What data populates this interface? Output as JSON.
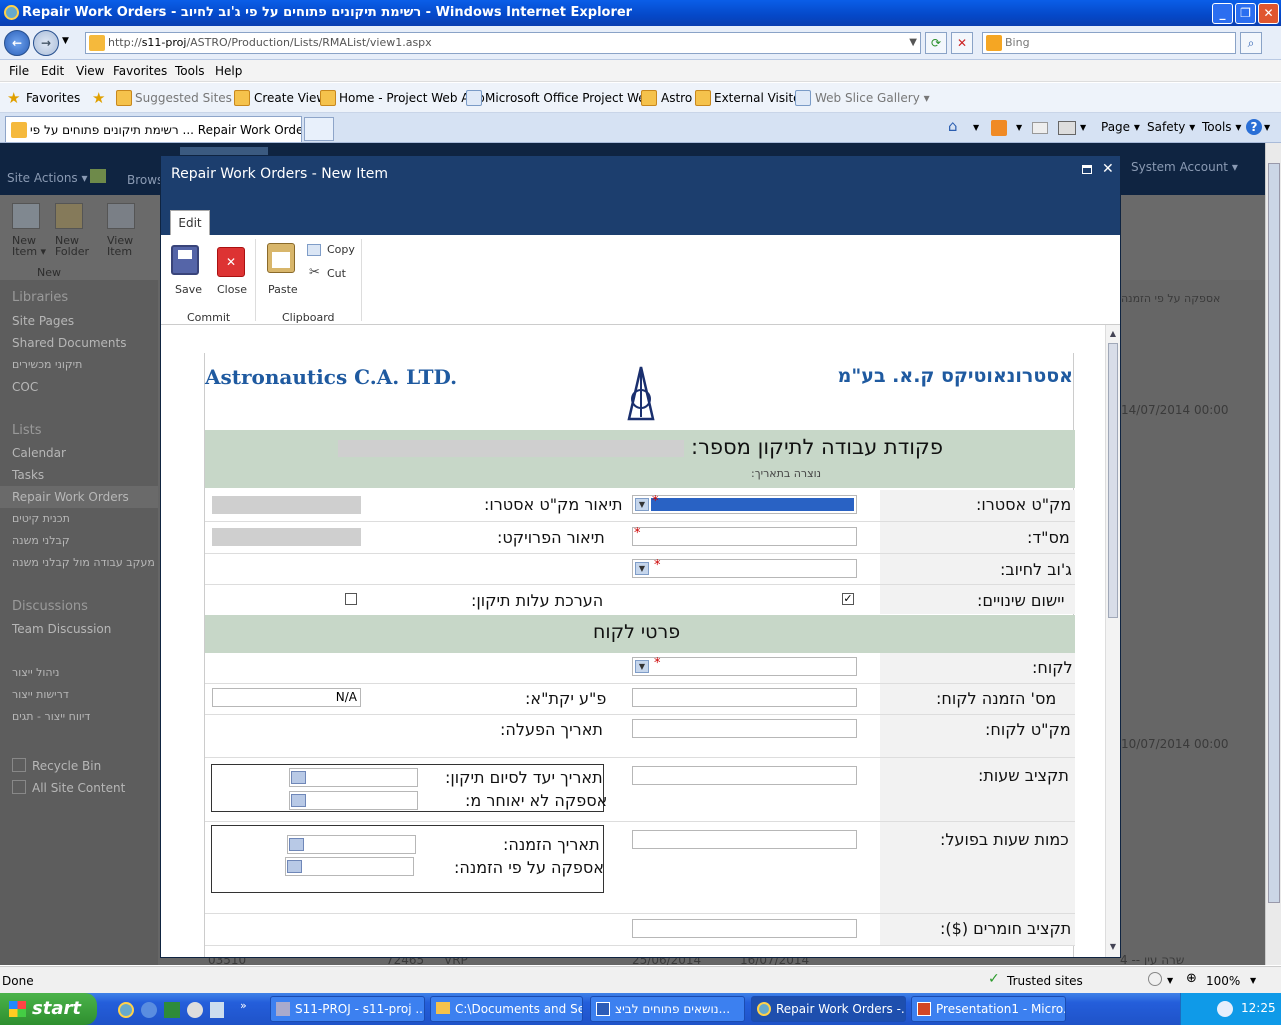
{
  "window": {
    "title": "Repair Work Orders - רשימת תיקונים פתוחים על פי ג'וב לחיוב - Windows Internet Explorer"
  },
  "address": {
    "url_prefix": "http://",
    "url_host": "s11-proj",
    "url_path": "/ASTRO/Production/Lists/RMAList/view1.aspx",
    "search_placeholder": "Bing"
  },
  "menu": [
    "File",
    "Edit",
    "View",
    "Favorites",
    "Tools",
    "Help"
  ],
  "favorites": {
    "label": "Favorites",
    "items": [
      "Suggested Sites ▾",
      "Create View",
      "Home - Project Web App",
      "Microsoft Office Project We...",
      "Astro",
      "External Visitor",
      "Web Slice Gallery ▾"
    ]
  },
  "tab": {
    "title": "רשימת תיקונים פתוחים על פי ... Repair Work Orders"
  },
  "commandbar": {
    "page": "Page ▾",
    "safety": "Safety ▾",
    "tools": "Tools ▾"
  },
  "sharepoint": {
    "site_actions": "Site Actions ▾",
    "browse": "Brows",
    "system_account": "System Account ▾",
    "ribbon": [
      "New Item ▾",
      "New Folder",
      "View Item"
    ],
    "ribbon_group": "New",
    "libraries": "Libraries",
    "lib_items": [
      "Site Pages",
      "Shared Documents",
      "תיקוני מכשירים",
      "COC"
    ],
    "lists": "Lists",
    "list_items": [
      "Calendar",
      "Tasks",
      "Repair Work Orders",
      "תכנית קיטים",
      "קבלני משנה",
      "מעקב עבודה מול קבלני משנה"
    ],
    "discussions": "Discussions",
    "disc_items": [
      "Team Discussion"
    ],
    "other_items": [
      "ניהול ייצור",
      "דרישות ייצור",
      "דיווח ייצור - תגים"
    ],
    "recycle": "Recycle Bin",
    "all_content": "All Site Content",
    "right_texts": [
      "אספקה על פי הזמנה",
      "14/07/2014 00:00",
      "10/07/2014 00:00"
    ],
    "bottom_row": [
      "03510",
      "72465",
      "VRP",
      "25/06/2014",
      "16/07/2014",
      "4 -- שרה עין"
    ]
  },
  "dialog": {
    "title": "Repair Work Orders - New Item",
    "tab": "Edit",
    "buttons": {
      "save": "Save",
      "close": "Close",
      "paste": "Paste",
      "copy": "Copy",
      "cut": "Cut"
    },
    "groups": {
      "commit": "Commit",
      "clipboard": "Clipboard"
    }
  },
  "form": {
    "company_en": "Astronautics C.A. LTD.",
    "company_he": "אסטרונאוטיקס ק.א. בע\"מ",
    "title": "פקודת עבודה לתיקון מספר:",
    "created": "נוצרה בתאריך:",
    "astro_pn": "מק\"ט אסטרו:",
    "astro_pn_desc": "תיאור מק\"ט אסטרו:",
    "serial": "מס\"ד:",
    "project_desc": "תיאור הפרויקט:",
    "job": "ג'וב לחיוב:",
    "apply_changes": "יישום שינויים:",
    "cost_estimate": "הערכת עלות תיקון:",
    "apply_changes_checked": "✓",
    "customer_section": "פרטי לקוח",
    "customer": "לקוח:",
    "customer_order": "מס' הזמנה לקוח:",
    "qa": "פ\"ע יקת\"א:",
    "qa_value": "N/A",
    "customer_pn": "מק\"ט לקוח:",
    "activation_date": "תאריך הפעלה:",
    "hours_budget": "תקציב שעות:",
    "target_date": "תאריך יעד לסיום תיקון:",
    "delivery_by": "אספקה לא יאוחר מ:",
    "actual_hours": "כמות שעות בפועל:",
    "order_date": "תאריך הזמנה:",
    "delivery_order": "אספקה על פי הזמנה:",
    "materials_budget": "תקציב חומרים ($):"
  },
  "status": {
    "left": "Done",
    "zone": "Trusted sites",
    "zoom": "100%"
  },
  "taskbar": {
    "start": "start",
    "items": [
      "S11-PROJ - s11-proj ...",
      "C:\\Documents and Se...",
      "נושאים פתוחים לביצ...",
      "Repair Work Orders -...",
      "Presentation1 - Micro..."
    ],
    "lang": "EN",
    "clock": "12:25"
  },
  "colors": {
    "dialog_header": "#1c3e6e",
    "section_green": "#c7d7c8",
    "company_blue": "#1f5aa0"
  }
}
